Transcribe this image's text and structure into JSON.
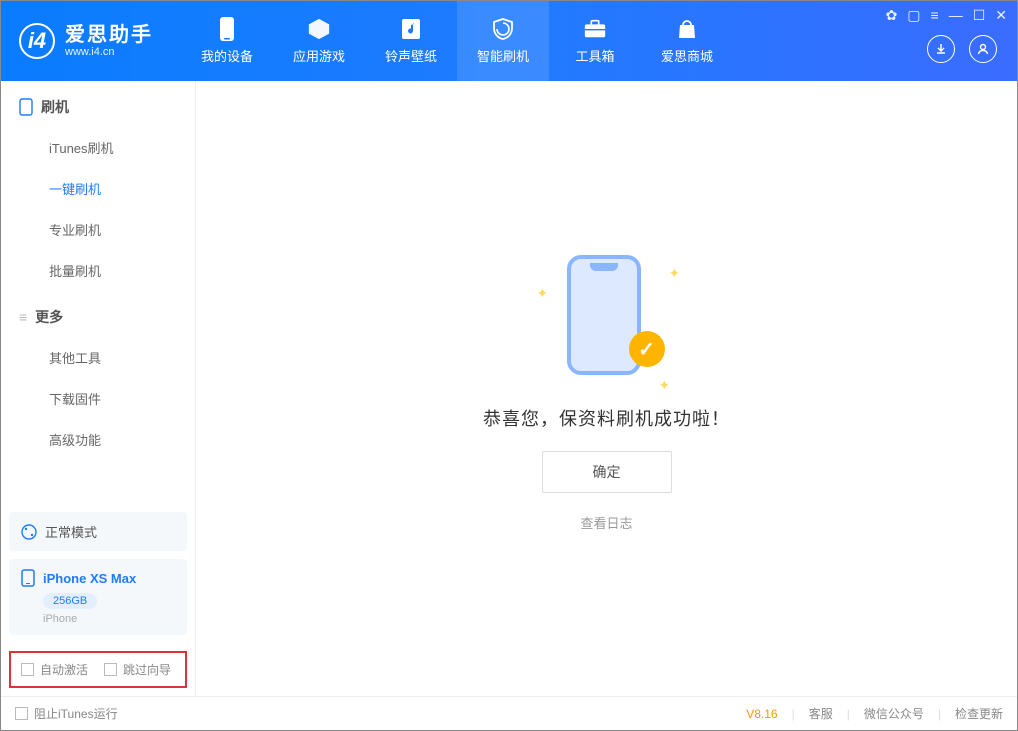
{
  "app": {
    "title": "爱思助手",
    "subtitle": "www.i4.cn"
  },
  "nav": {
    "tabs": [
      {
        "label": "我的设备"
      },
      {
        "label": "应用游戏"
      },
      {
        "label": "铃声壁纸"
      },
      {
        "label": "智能刷机"
      },
      {
        "label": "工具箱"
      },
      {
        "label": "爱思商城"
      }
    ]
  },
  "sidebar": {
    "section1_title": "刷机",
    "items1": [
      {
        "label": "iTunes刷机"
      },
      {
        "label": "一键刷机"
      },
      {
        "label": "专业刷机"
      },
      {
        "label": "批量刷机"
      }
    ],
    "section2_title": "更多",
    "items2": [
      {
        "label": "其他工具"
      },
      {
        "label": "下载固件"
      },
      {
        "label": "高级功能"
      }
    ],
    "mode": "正常模式",
    "device": {
      "name": "iPhone XS Max",
      "storage": "256GB",
      "type": "iPhone"
    },
    "check1": "自动激活",
    "check2": "跳过向导"
  },
  "main": {
    "success_text": "恭喜您，保资料刷机成功啦！",
    "confirm": "确定",
    "view_log": "查看日志"
  },
  "footer": {
    "block_itunes": "阻止iTunes运行",
    "version": "V8.16",
    "links": [
      "客服",
      "微信公众号",
      "检查更新"
    ]
  }
}
